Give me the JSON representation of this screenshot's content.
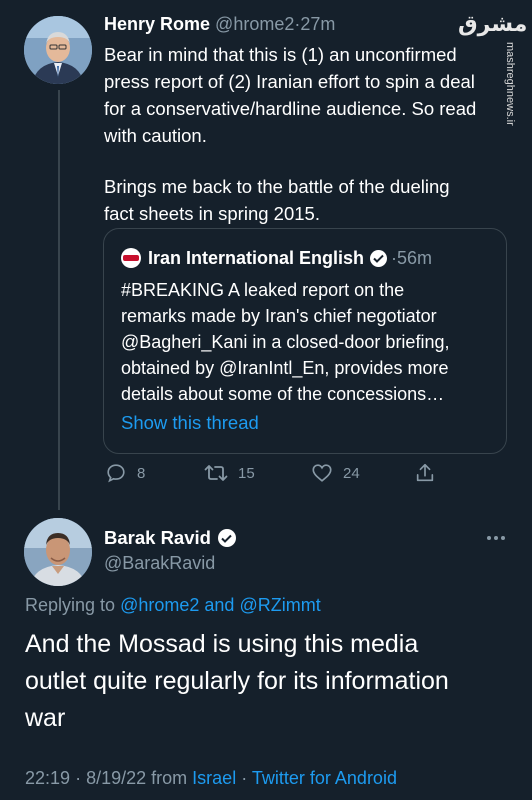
{
  "tweet1": {
    "author_name": "Henry Rome",
    "author_handle": "@hrome2",
    "separator": "·",
    "time": "27m",
    "paragraph1": "Bear in mind that this is (1) an unconfirmed\npress report of (2) Iranian effort to spin a deal\nfor a conservative/hardline audience. So read\nwith caution.",
    "paragraph2": "Brings me back to the battle of the dueling\nfact sheets in spring 2015.",
    "quote": {
      "author_name": "Iran International English",
      "separator": "·",
      "time": "56m",
      "text": "#BREAKING A leaked report on the\nremarks made by Iran's chief negotiator\n@Bagheri_Kani in a closed-door briefing,\nobtained by @IranIntl_En, provides more\ndetails about some of the concessions…",
      "show_thread_label": "Show this thread"
    },
    "actions": {
      "replies": "8",
      "retweets": "15",
      "likes": "24"
    }
  },
  "tweet2": {
    "author_name": "Barak Ravid",
    "author_handle": "@BarakRavid",
    "replying_prefix": "Replying to",
    "replying_user1": "@hrome2",
    "replying_and": "and",
    "replying_user2": "@RZimmt",
    "text": "And the Mossad is using this media\noutlet quite regularly for its information\nwar",
    "time": "22:19",
    "dot1": "·",
    "date": "8/19/22",
    "from_label": "from",
    "location": "Israel",
    "dot2": "·",
    "client": "Twitter for Android"
  },
  "watermark": {
    "logo_text": "مشرق",
    "site": "mashreghnews.ir"
  },
  "icons": {
    "verified": "verified-badge-icon",
    "reply": "reply-icon",
    "retweet": "retweet-icon",
    "like": "heart-icon",
    "share": "share-icon",
    "more": "more-icon"
  },
  "colors": {
    "background": "#15202b",
    "text": "#ffffff",
    "muted": "#8899a6",
    "link": "#1d9bf0",
    "border": "#38444d"
  }
}
